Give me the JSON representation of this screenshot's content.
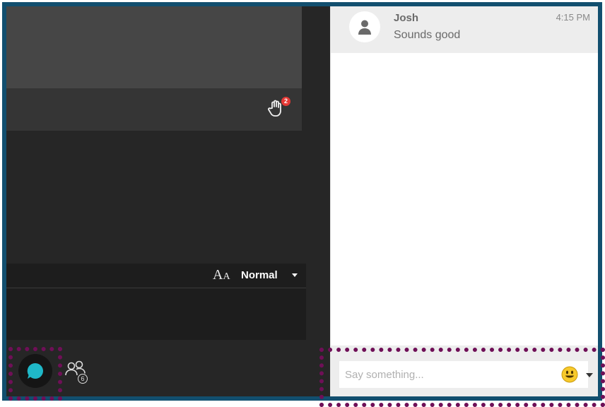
{
  "meeting": {
    "raised_hands_count": "2"
  },
  "captions": {
    "font_size_value": "Normal"
  },
  "toolbar": {
    "participants_count": "6"
  },
  "chat": {
    "messages": [
      {
        "author": "Josh",
        "time": "4:15 PM",
        "text": "Sounds good"
      }
    ],
    "composer_placeholder": "Say something..."
  },
  "colors": {
    "frame_border": "#124f6f",
    "highlight_dotted": "#6f0f57",
    "chat_accent": "#1fb8c8",
    "badge_red": "#e53935"
  },
  "icons": [
    "raise-hand-icon",
    "font-size-icon",
    "chevron-down-icon",
    "chat-bubble-icon",
    "participants-icon",
    "user-avatar-icon",
    "emoji-icon"
  ]
}
